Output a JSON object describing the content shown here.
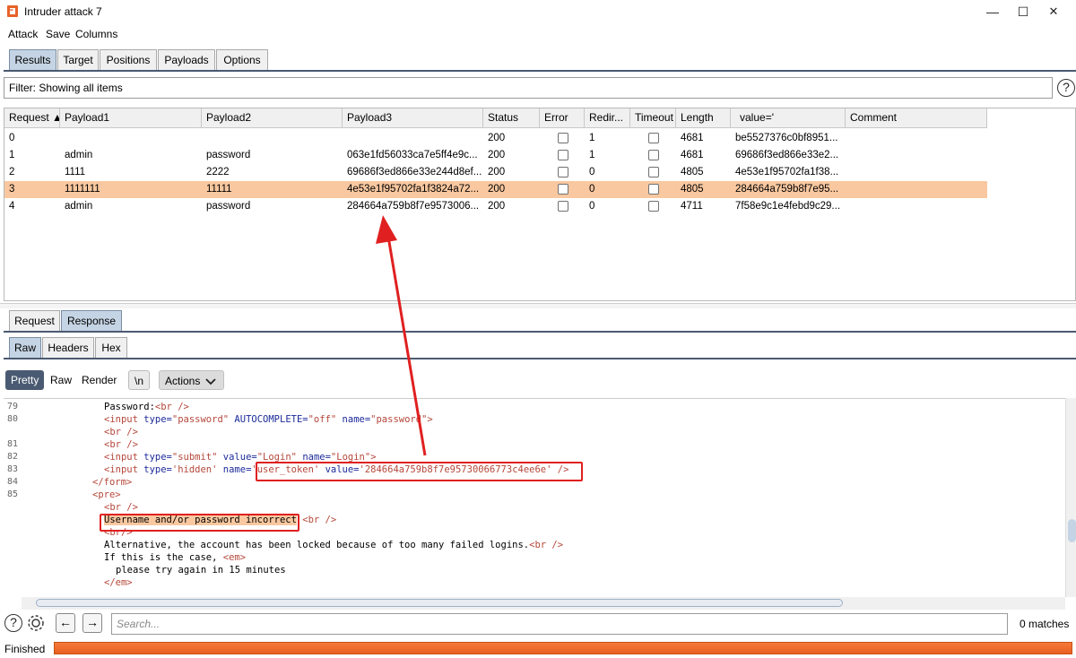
{
  "window": {
    "title": "Intruder attack 7",
    "minimize": "—",
    "maximize": "☐",
    "close": "✕"
  },
  "menu": [
    "Attack",
    "Save",
    "Columns"
  ],
  "main_tabs": [
    "Results",
    "Target",
    "Positions",
    "Payloads",
    "Options"
  ],
  "filter": {
    "text": "Filter: Showing all items",
    "help": "?"
  },
  "table": {
    "columns": [
      "Request ▲",
      "Payload1",
      "Payload2",
      "Payload3",
      "Status",
      "Error",
      "Redir...",
      "Timeout",
      "Length",
      "value='",
      "Comment"
    ],
    "rows": [
      {
        "request": "0",
        "payload1": "",
        "payload2": "",
        "payload3": "",
        "status": "200",
        "redir": "1",
        "length": "4681",
        "value": "be5527376c0bf8951..."
      },
      {
        "request": "1",
        "payload1": "admin",
        "payload2": "password",
        "payload3": "063e1fd56033ca7e5ff4e9c...",
        "status": "200",
        "redir": "1",
        "length": "4681",
        "value": "69686f3ed866e33e2..."
      },
      {
        "request": "2",
        "payload1": "1111",
        "payload2": "2222",
        "payload3": "69686f3ed866e33e244d8ef...",
        "status": "200",
        "redir": "0",
        "length": "4805",
        "value": "4e53e1f95702fa1f38..."
      },
      {
        "request": "3",
        "payload1": "1111111",
        "payload2": "11111",
        "payload3": "4e53e1f95702fa1f3824a72...",
        "status": "200",
        "redir": "0",
        "length": "4805",
        "value": "284664a759b8f7e95..."
      },
      {
        "request": "4",
        "payload1": "admin",
        "payload2": "password",
        "payload3": "284664a759b8f7e9573006...",
        "status": "200",
        "redir": "0",
        "length": "4711",
        "value": "7f58e9c1e4febd9c29..."
      }
    ],
    "selected_row": "3"
  },
  "rr_tabs": [
    "Request",
    "Response"
  ],
  "view_tabs": [
    "Raw",
    "Headers",
    "Hex"
  ],
  "editor_toolbar": {
    "pretty": "Pretty",
    "raw": "Raw",
    "render": "Render",
    "newline": "\\n",
    "actions": "Actions",
    "actions_icon": "chevron-down"
  },
  "code": {
    "line_numbers": [
      "79",
      "80",
      "",
      "81",
      "82",
      "83",
      "84",
      "85"
    ],
    "l1": {
      "text": "Password:",
      "tag": "<br />"
    },
    "l2": {
      "open": "<input",
      "a1": "type=",
      "v1": "\"password\"",
      "a2": "AUTOCOMPLETE=",
      "v2": "\"off\"",
      "a3": "name=",
      "v3": "\"password\"",
      "close": ">"
    },
    "l3": "<br />",
    "l4": "<br />",
    "l5": {
      "open": "<input",
      "a1": "type=",
      "v1": "\"submit\"",
      "a2": "value=",
      "v2": "\"Login\"",
      "a3": "name=",
      "v3": "\"Login\"",
      "close": ">"
    },
    "l6": {
      "open": "<input",
      "a1": "type=",
      "v1": "'hidden'",
      "a2": "name=",
      "v2": "'user_token'",
      "a3": "value=",
      "v3": "'284664a759b8f7e95730066773c4ee6e'",
      "close": "/>"
    },
    "l7": "</form>",
    "l8": "<pre>",
    "l9": "<br />",
    "l10": {
      "text": "Username and/or password incorrect",
      "tag": "<br />"
    },
    "l11": "<br/>",
    "l12": {
      "text": "Alternative, the account has been locked because of too many failed logins.",
      "tag": "<br />"
    },
    "l13": {
      "text": "If this is the case,",
      "tag": "<em>"
    },
    "l14": "please try again in 15 minutes",
    "l15": "</em>"
  },
  "search": {
    "placeholder": "Search...",
    "matches": "0 matches",
    "prev": "←",
    "next": "→"
  },
  "status": {
    "text": "Finished",
    "progress": 1.0
  },
  "colors": {
    "accent": "#4a5a72",
    "selected_row": "#f9c8a0",
    "annotation": "#e02020",
    "progress": "#f57a3a"
  }
}
